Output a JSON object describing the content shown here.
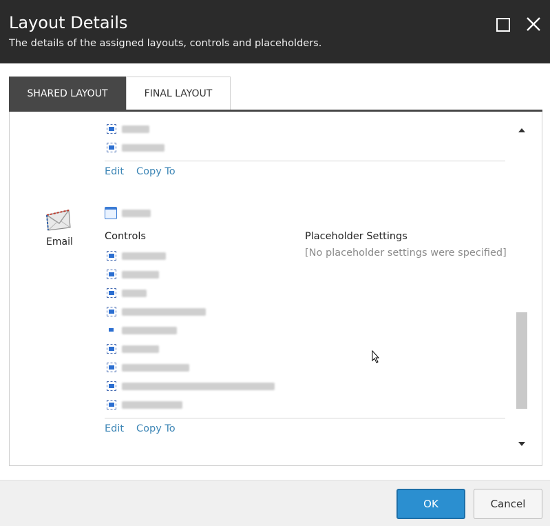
{
  "dialog": {
    "title": "Layout Details",
    "subtitle": "The details of the assigned layouts, controls and placeholders."
  },
  "tabs": [
    {
      "label": "SHARED LAYOUT",
      "active": true
    },
    {
      "label": "FINAL LAYOUT",
      "active": false
    }
  ],
  "top_section": {
    "edit_label": "Edit",
    "copy_to_label": "Copy To"
  },
  "email_section": {
    "device_label": "Email",
    "controls_header": "Controls",
    "placeholder_header": "Placeholder Settings",
    "placeholder_note": "[No placeholder settings were specified]",
    "edit_label": "Edit",
    "copy_to_label": "Copy To"
  },
  "footer": {
    "ok_label": "OK",
    "cancel_label": "Cancel"
  },
  "colors": {
    "titlebar": "#2b2b2b",
    "active_tab": "#474747",
    "link": "#3d86b6",
    "ok_button": "#2b8fd0"
  }
}
